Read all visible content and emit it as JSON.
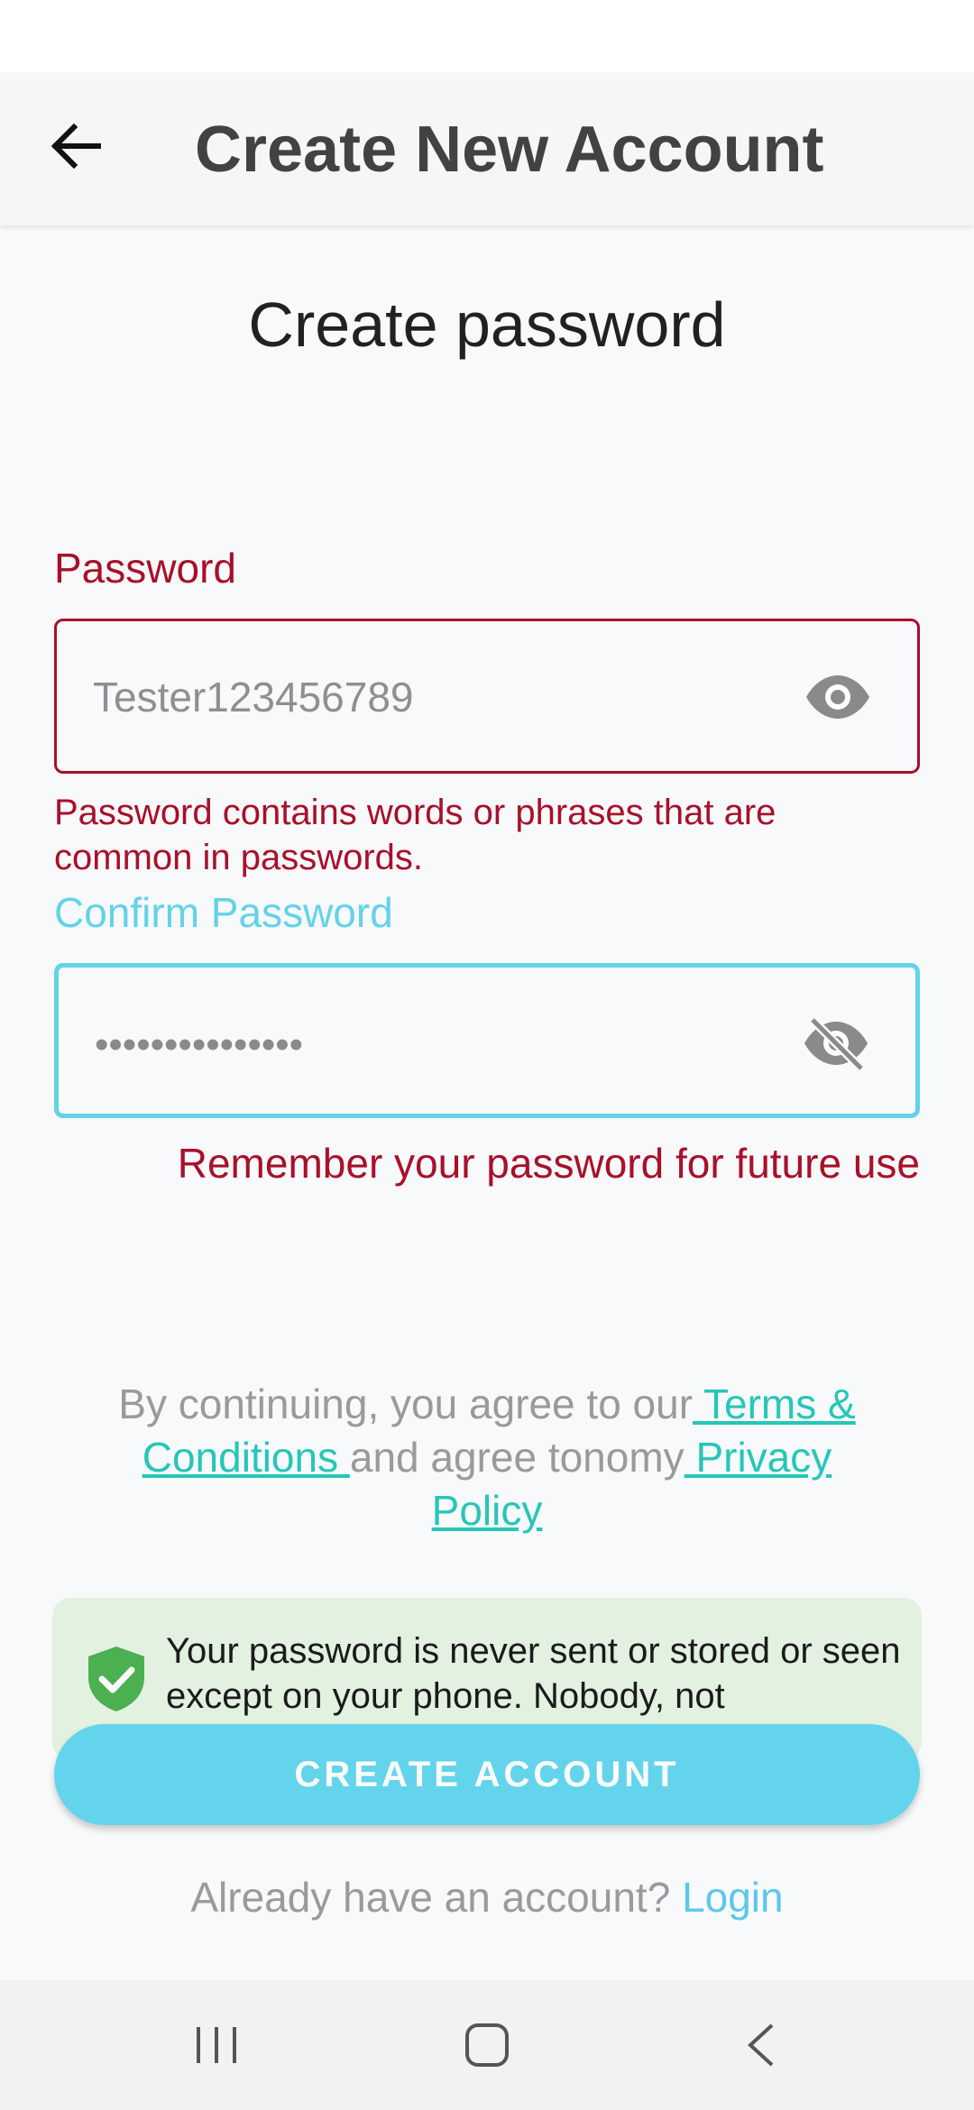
{
  "app_bar": {
    "title": "Create New Account"
  },
  "page": {
    "heading": "Create password"
  },
  "password": {
    "label": "Password",
    "value": "Tester123456789",
    "error": "Password contains words or phrases that are common in passwords."
  },
  "confirm": {
    "label": "Confirm Password",
    "value": "•••••••••••••••",
    "hint": "Remember your password for future use"
  },
  "agreement": {
    "prefix": "By continuing, you agree to our",
    "terms_link": " Terms & Conditions ",
    "middle": "and agree tonomy",
    "privacy_link": " Privacy Policy "
  },
  "info_card": {
    "text": "Your password is never sent or stored or seen except on your phone. Nobody, not"
  },
  "create_button": {
    "label": "CREATE ACCOUNT"
  },
  "login": {
    "prompt": "Already have an account? ",
    "link": "Login"
  },
  "colors": {
    "accent": "#64d4ec",
    "error": "#a8102a",
    "link": "#26c6b8",
    "info_bg": "#e2f1e0",
    "shield": "#4caf50"
  }
}
